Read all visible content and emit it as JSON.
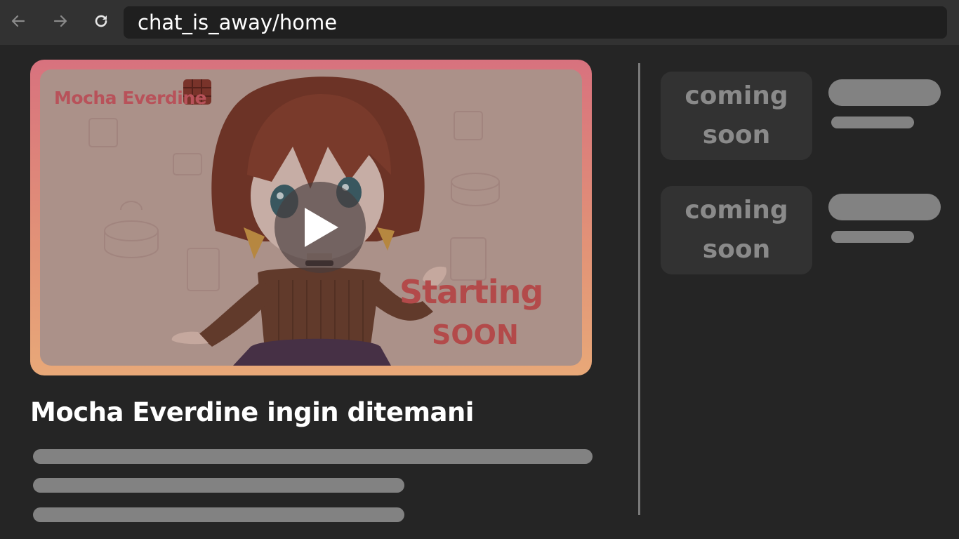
{
  "browser": {
    "url": "chat_is_away/home"
  },
  "video": {
    "title": "Mocha Everdine ingin ditemani",
    "thumbnail": {
      "name_text": "Mocha Everdine",
      "status_line1": "Starting",
      "status_line2": "SOON"
    }
  },
  "sidebar": {
    "cards": [
      {
        "line1": "coming",
        "line2": "soon"
      },
      {
        "line1": "coming",
        "line2": "soon"
      }
    ]
  },
  "icons": {
    "back": "arrow-left-icon",
    "forward": "arrow-right-icon",
    "reload": "reload-icon",
    "play": "play-icon"
  }
}
